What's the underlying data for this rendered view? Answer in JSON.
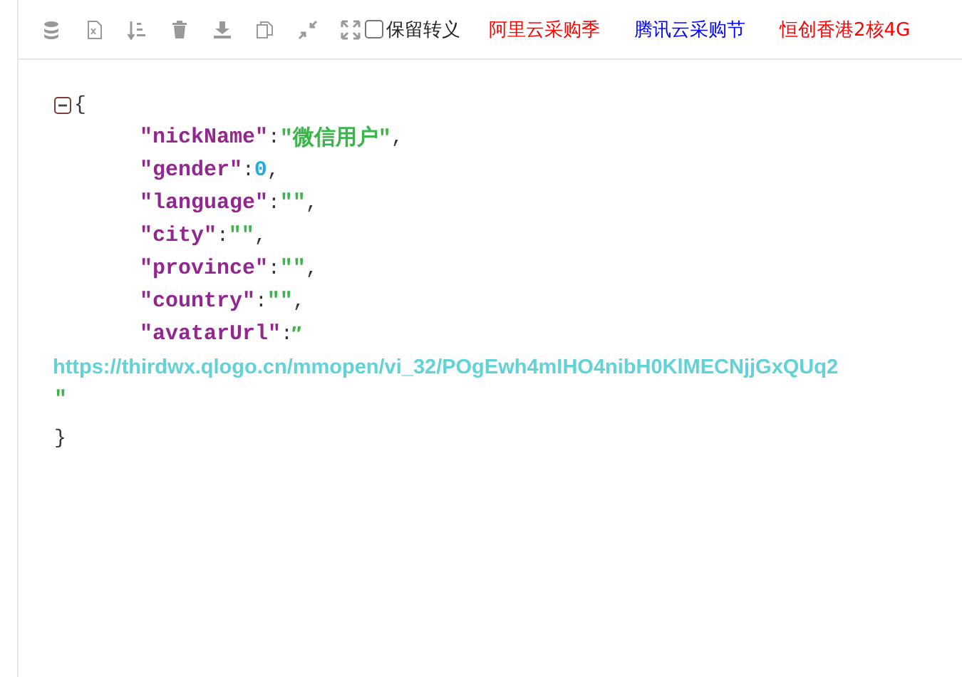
{
  "toolbar": {
    "checkbox": {
      "label": "保留转义",
      "checked": false
    },
    "links": [
      {
        "text": "阿里云采购季",
        "color": "#ff0000"
      },
      {
        "text": "腾讯云采购节",
        "color": "#0000ff"
      },
      {
        "text": "恒创香港2核4G",
        "color": "#ff0000"
      }
    ]
  },
  "editor": {
    "expanded": true,
    "open": "{",
    "close": "}",
    "fields": [
      {
        "kind": "string",
        "key": "″nickName″",
        "sep": ":",
        "value": "″微信用户″",
        "end": ","
      },
      {
        "kind": "number",
        "key": "″gender″",
        "sep": ":",
        "value": "0",
        "end": ","
      },
      {
        "kind": "string",
        "key": "″language″",
        "sep": ":",
        "value": "″″",
        "end": ","
      },
      {
        "kind": "string",
        "key": "″city″",
        "sep": ":",
        "value": "″″",
        "end": ","
      },
      {
        "kind": "string",
        "key": "″province″",
        "sep": ":",
        "value": "″″",
        "end": ","
      },
      {
        "kind": "string",
        "key": "″country″",
        "sep": ":",
        "value": "″″",
        "end": ","
      },
      {
        "kind": "url",
        "key": "″avatarUrl″",
        "sep": ":",
        "value": "″",
        "url": "https://thirdwx.qlogo.cn/mmopen/vi_32/POgEwh4mIHO4nibH0KlMECNjjGxQUq2",
        "tail": "″"
      }
    ]
  }
}
